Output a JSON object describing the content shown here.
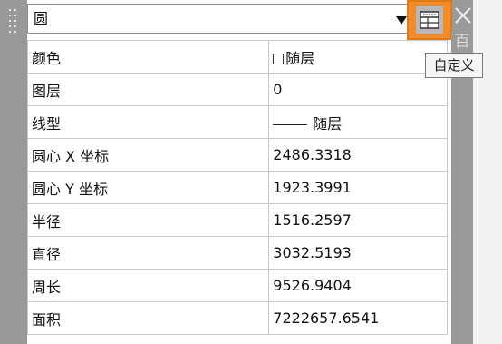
{
  "dropdown": {
    "selected": "圆"
  },
  "toolbar": {
    "customize_tooltip": "自定义"
  },
  "properties": [
    {
      "label": "颜色",
      "value": "随层"
    },
    {
      "label": "图层",
      "value": "0"
    },
    {
      "label": "线型",
      "value": "随层"
    },
    {
      "label": "圆心 X 坐标",
      "value": "2486.3318"
    },
    {
      "label": "圆心 Y 坐标",
      "value": "1923.3991"
    },
    {
      "label": "半径",
      "value": "1516.2597"
    },
    {
      "label": "直径",
      "value": "3032.5193"
    },
    {
      "label": "周长",
      "value": "9526.9404"
    },
    {
      "label": "面积",
      "value": "7222657.6541"
    }
  ],
  "side_strip": {
    "glyph": "百"
  },
  "icons": [
    "grip-icon",
    "dropdown-arrow-icon",
    "customize-icon",
    "close-icon",
    "color-swatch-icon",
    "linetype-sample-icon"
  ],
  "colors": {
    "highlight": "#f28c2a",
    "panel_bg": "#ffffff",
    "chrome_bg": "#9a9a9a",
    "grid_line": "#c8c8c8"
  }
}
